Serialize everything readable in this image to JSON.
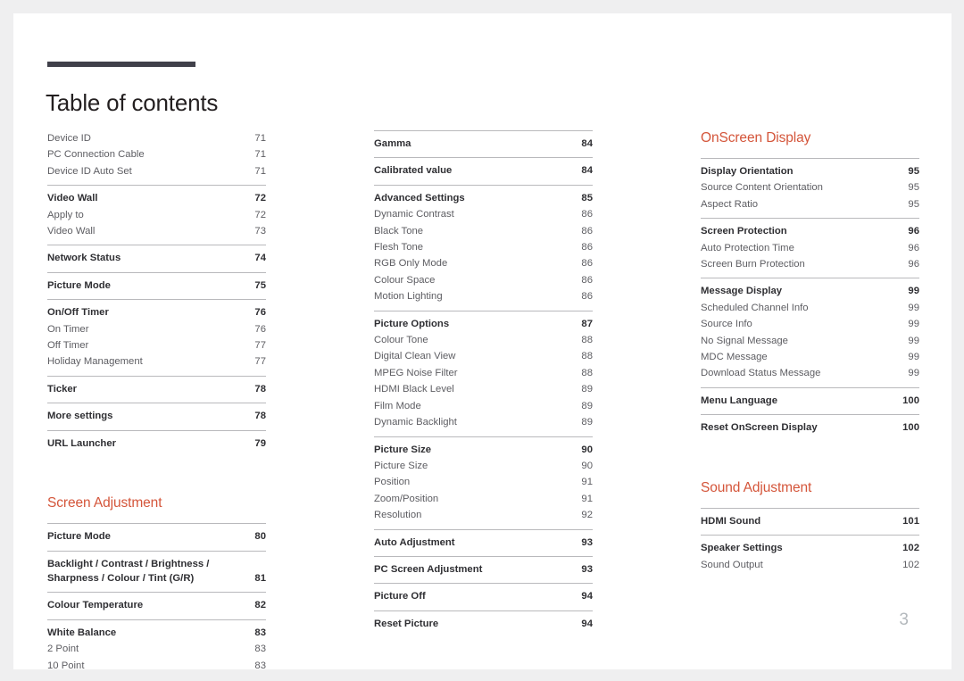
{
  "document": {
    "title": "Table of contents",
    "page_number": "3",
    "accent_color": "#d4553a",
    "rule_color": "#40404a"
  },
  "columns": [
    {
      "name": "column-left",
      "blocks": [
        {
          "type": "group",
          "rule": false,
          "entries": [
            {
              "label": "Device ID",
              "page": "71",
              "head": false
            },
            {
              "label": "PC Connection Cable",
              "page": "71",
              "head": false
            },
            {
              "label": "Device ID Auto Set",
              "page": "71",
              "head": false
            }
          ]
        },
        {
          "type": "group",
          "rule": true,
          "entries": [
            {
              "label": "Video Wall",
              "page": "72",
              "head": true
            },
            {
              "label": "Apply to",
              "page": "72",
              "head": false
            },
            {
              "label": "Video Wall",
              "page": "73",
              "head": false
            }
          ]
        },
        {
          "type": "group",
          "rule": true,
          "entries": [
            {
              "label": "Network Status",
              "page": "74",
              "head": true
            }
          ]
        },
        {
          "type": "group",
          "rule": true,
          "entries": [
            {
              "label": "Picture Mode",
              "page": "75",
              "head": true
            }
          ]
        },
        {
          "type": "group",
          "rule": true,
          "entries": [
            {
              "label": "On/Off Timer",
              "page": "76",
              "head": true
            },
            {
              "label": "On Timer",
              "page": "76",
              "head": false
            },
            {
              "label": "Off Timer",
              "page": "77",
              "head": false
            },
            {
              "label": "Holiday Management",
              "page": "77",
              "head": false
            }
          ]
        },
        {
          "type": "group",
          "rule": true,
          "entries": [
            {
              "label": "Ticker",
              "page": "78",
              "head": true
            }
          ]
        },
        {
          "type": "group",
          "rule": true,
          "entries": [
            {
              "label": "More settings",
              "page": "78",
              "head": true
            }
          ]
        },
        {
          "type": "group",
          "rule": true,
          "entries": [
            {
              "label": "URL Launcher",
              "page": "79",
              "head": true
            }
          ]
        },
        {
          "type": "heading",
          "label": "Screen Adjustment",
          "spaced": true
        },
        {
          "type": "group",
          "rule": true,
          "entries": [
            {
              "label": "Picture Mode",
              "page": "80",
              "head": true
            }
          ]
        },
        {
          "type": "group",
          "rule": true,
          "entries": [
            {
              "label": "Backlight / Contrast / Brightness /\nSharpness / Colour / Tint (G/R)",
              "page": "81",
              "head": true
            }
          ]
        },
        {
          "type": "group",
          "rule": true,
          "entries": [
            {
              "label": "Colour Temperature",
              "page": "82",
              "head": true
            }
          ]
        },
        {
          "type": "group",
          "rule": true,
          "entries": [
            {
              "label": "White Balance",
              "page": "83",
              "head": true
            },
            {
              "label": "2 Point",
              "page": "83",
              "head": false
            },
            {
              "label": "10 Point",
              "page": "83",
              "head": false
            }
          ]
        }
      ]
    },
    {
      "name": "column-middle",
      "blocks": [
        {
          "type": "group",
          "rule": true,
          "entries": [
            {
              "label": "Gamma",
              "page": "84",
              "head": true
            }
          ]
        },
        {
          "type": "group",
          "rule": true,
          "entries": [
            {
              "label": "Calibrated value",
              "page": "84",
              "head": true
            }
          ]
        },
        {
          "type": "group",
          "rule": true,
          "entries": [
            {
              "label": "Advanced Settings",
              "page": "85",
              "head": true
            },
            {
              "label": "Dynamic Contrast",
              "page": "86",
              "head": false
            },
            {
              "label": "Black Tone",
              "page": "86",
              "head": false
            },
            {
              "label": "Flesh Tone",
              "page": "86",
              "head": false
            },
            {
              "label": "RGB Only Mode",
              "page": "86",
              "head": false
            },
            {
              "label": "Colour Space",
              "page": "86",
              "head": false
            },
            {
              "label": "Motion Lighting",
              "page": "86",
              "head": false
            }
          ]
        },
        {
          "type": "group",
          "rule": true,
          "entries": [
            {
              "label": "Picture Options",
              "page": "87",
              "head": true
            },
            {
              "label": "Colour Tone",
              "page": "88",
              "head": false
            },
            {
              "label": "Digital Clean View",
              "page": "88",
              "head": false
            },
            {
              "label": "MPEG Noise Filter",
              "page": "88",
              "head": false
            },
            {
              "label": "HDMI Black Level",
              "page": "89",
              "head": false
            },
            {
              "label": "Film Mode",
              "page": "89",
              "head": false
            },
            {
              "label": "Dynamic Backlight",
              "page": "89",
              "head": false
            }
          ]
        },
        {
          "type": "group",
          "rule": true,
          "entries": [
            {
              "label": "Picture Size",
              "page": "90",
              "head": true
            },
            {
              "label": "Picture Size",
              "page": "90",
              "head": false
            },
            {
              "label": "Position",
              "page": "91",
              "head": false
            },
            {
              "label": "Zoom/Position",
              "page": "91",
              "head": false
            },
            {
              "label": "Resolution",
              "page": "92",
              "head": false
            }
          ]
        },
        {
          "type": "group",
          "rule": true,
          "entries": [
            {
              "label": "Auto Adjustment",
              "page": "93",
              "head": true
            }
          ]
        },
        {
          "type": "group",
          "rule": true,
          "entries": [
            {
              "label": "PC Screen Adjustment",
              "page": "93",
              "head": true
            }
          ]
        },
        {
          "type": "group",
          "rule": true,
          "entries": [
            {
              "label": "Picture Off",
              "page": "94",
              "head": true
            }
          ]
        },
        {
          "type": "group",
          "rule": true,
          "entries": [
            {
              "label": "Reset Picture",
              "page": "94",
              "head": true
            }
          ]
        }
      ]
    },
    {
      "name": "column-right",
      "blocks": [
        {
          "type": "heading",
          "label": "OnScreen Display",
          "spaced": false
        },
        {
          "type": "group",
          "rule": true,
          "entries": [
            {
              "label": "Display Orientation",
              "page": "95",
              "head": true
            },
            {
              "label": "Source Content Orientation",
              "page": "95",
              "head": false
            },
            {
              "label": "Aspect Ratio",
              "page": "95",
              "head": false
            }
          ]
        },
        {
          "type": "group",
          "rule": true,
          "entries": [
            {
              "label": "Screen Protection",
              "page": "96",
              "head": true
            },
            {
              "label": "Auto Protection Time",
              "page": "96",
              "head": false
            },
            {
              "label": "Screen Burn Protection",
              "page": "96",
              "head": false
            }
          ]
        },
        {
          "type": "group",
          "rule": true,
          "entries": [
            {
              "label": "Message Display",
              "page": "99",
              "head": true
            },
            {
              "label": "Scheduled Channel Info",
              "page": "99",
              "head": false
            },
            {
              "label": "Source Info",
              "page": "99",
              "head": false
            },
            {
              "label": "No Signal Message",
              "page": "99",
              "head": false
            },
            {
              "label": "MDC Message",
              "page": "99",
              "head": false
            },
            {
              "label": "Download Status Message",
              "page": "99",
              "head": false
            }
          ]
        },
        {
          "type": "group",
          "rule": true,
          "entries": [
            {
              "label": "Menu Language",
              "page": "100",
              "head": true
            }
          ]
        },
        {
          "type": "group",
          "rule": true,
          "entries": [
            {
              "label": "Reset OnScreen Display",
              "page": "100",
              "head": true
            }
          ]
        },
        {
          "type": "heading",
          "label": "Sound Adjustment",
          "spaced": true
        },
        {
          "type": "group",
          "rule": true,
          "entries": [
            {
              "label": "HDMI Sound",
              "page": "101",
              "head": true
            }
          ]
        },
        {
          "type": "group",
          "rule": true,
          "entries": [
            {
              "label": "Speaker Settings",
              "page": "102",
              "head": true
            },
            {
              "label": "Sound Output",
              "page": "102",
              "head": false
            }
          ]
        }
      ]
    }
  ]
}
